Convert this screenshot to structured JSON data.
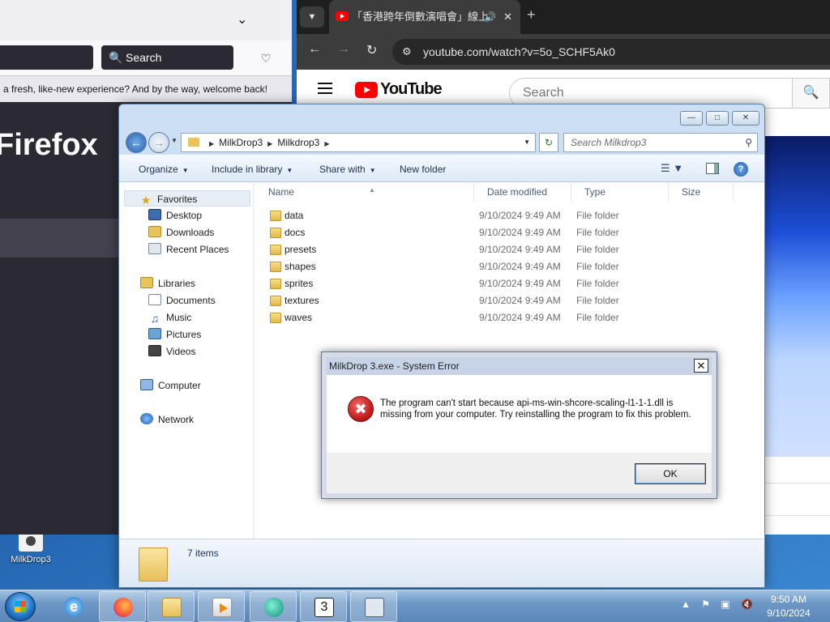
{
  "firefox": {
    "search_placeholder": "Search",
    "notice": "a fresh, like-new experience? And by the way, welcome back!",
    "brand": "Firefox"
  },
  "chrome": {
    "tab_title": "「香港跨年倒數演唱會」線上",
    "url": "youtube.com/watch?v=5o_SCHF5Ak0",
    "youtube_logo": "YouTube",
    "search_placeholder": "Search"
  },
  "explorer": {
    "breadcrumb": [
      "MilkDrop3",
      "Milkdrop3"
    ],
    "search_placeholder": "Search Milkdrop3",
    "commands": {
      "organize": "Organize",
      "include": "Include in library",
      "share": "Share with",
      "new_folder": "New folder"
    },
    "nav": {
      "favorites": "Favorites",
      "desktop": "Desktop",
      "downloads": "Downloads",
      "recent": "Recent Places",
      "libraries": "Libraries",
      "documents": "Documents",
      "music": "Music",
      "pictures": "Pictures",
      "videos": "Videos",
      "computer": "Computer",
      "network": "Network"
    },
    "columns": {
      "name": "Name",
      "date": "Date modified",
      "type": "Type",
      "size": "Size"
    },
    "files": [
      {
        "name": "data",
        "date": "9/10/2024 9:49 AM",
        "type": "File folder"
      },
      {
        "name": "docs",
        "date": "9/10/2024 9:49 AM",
        "type": "File folder"
      },
      {
        "name": "presets",
        "date": "9/10/2024 9:49 AM",
        "type": "File folder"
      },
      {
        "name": "shapes",
        "date": "9/10/2024 9:49 AM",
        "type": "File folder"
      },
      {
        "name": "sprites",
        "date": "9/10/2024 9:49 AM",
        "type": "File folder"
      },
      {
        "name": "textures",
        "date": "9/10/2024 9:49 AM",
        "type": "File folder"
      },
      {
        "name": "waves",
        "date": "9/10/2024 9:49 AM",
        "type": "File folder"
      }
    ],
    "item_count": "7 items"
  },
  "dialog": {
    "title": "MilkDrop 3.exe - System Error",
    "message": "The program can't start because api-ms-win-shcore-scaling-l1-1-1.dll is missing from your computer. Try reinstalling the program to fix this problem.",
    "ok": "OK"
  },
  "desktop": {
    "icon_label": "MilkDrop3"
  },
  "taskbar": {
    "time": "9:50 AM",
    "date": "9/10/2024"
  }
}
